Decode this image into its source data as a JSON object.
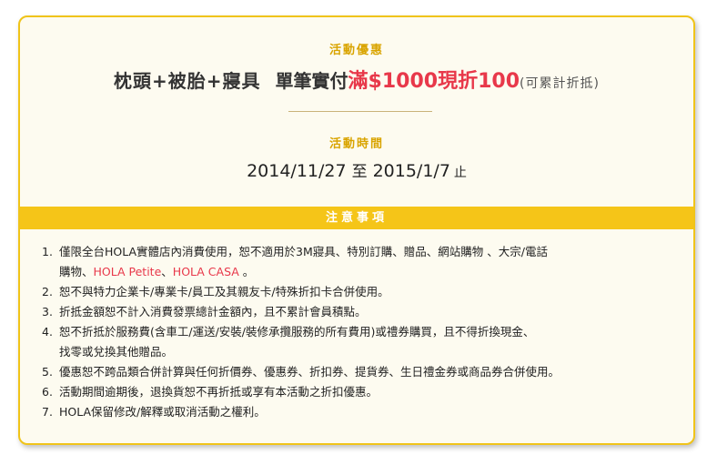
{
  "promo": {
    "label": "活動優惠",
    "headline_main": "枕頭+被胎+寢具",
    "headline_sub": "單筆實付",
    "headline_red": "滿$1000現折100",
    "headline_note": "(可累計折抵)"
  },
  "period": {
    "label": "活動時間",
    "start": "2014/11/27",
    "to": "至",
    "end": "2015/1/7",
    "stop": "止"
  },
  "notice": {
    "title": "注意事項",
    "items": [
      {
        "num": "1.",
        "parts": [
          "僅限全台HOLA實體店內消費使用，恕不適用於3M寢具、特別訂購、贈品、網站購物 、大宗/電話",
          "購物、",
          "HOLA Petite",
          "、",
          "HOLA CASA",
          " 。"
        ]
      },
      {
        "num": "2.",
        "text": "恕不與特力企業卡/專業卡/員工及其親友卡/特殊折扣卡合併使用。"
      },
      {
        "num": "3.",
        "text": "折抵金額恕不計入消費發票總計金額內，且不累計會員積點。"
      },
      {
        "num": "4.",
        "line1": "恕不折抵於服務費(含車工/運送/安裝/裝修承攬服務的所有費用)或禮券購買，且不得折換現金、",
        "line2": "找零或兌換其他贈品。"
      },
      {
        "num": "5.",
        "text": "優惠恕不跨品類合併計算與任何折價券、優惠券、折扣券、提貨券、生日禮金券或商品券合併使用。"
      },
      {
        "num": "6.",
        "text": "活動期間逾期後，退換貨恕不再折抵或享有本活動之折扣優惠。"
      },
      {
        "num": "7.",
        "text": "HOLA保留修改/解釋或取消活動之權利。"
      }
    ]
  },
  "colors": {
    "accent": "#f5c518",
    "label": "#d9a400",
    "highlight": "#e8384a",
    "border": "#f0c419"
  }
}
